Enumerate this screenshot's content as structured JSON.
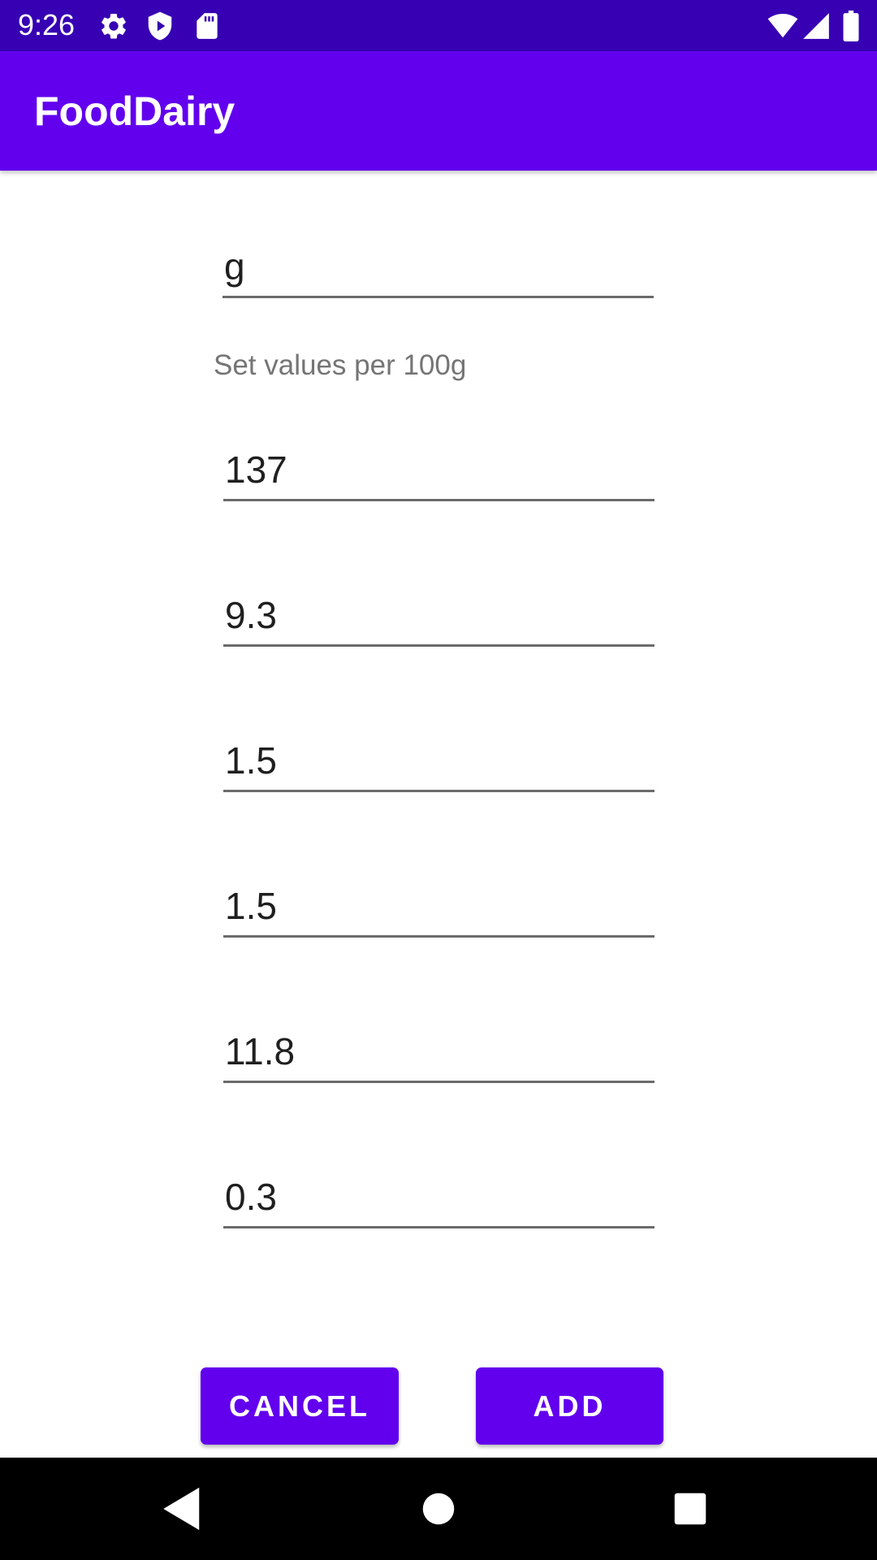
{
  "status_bar": {
    "time": "9:26",
    "icons": [
      "gear-icon",
      "shield-icon",
      "sd-card-icon",
      "wifi-icon",
      "signal-icon",
      "battery-icon"
    ]
  },
  "app_bar": {
    "title": "FoodDairy"
  },
  "form": {
    "unit_field": {
      "value": "g"
    },
    "hint": "Set values per 100g",
    "value_fields": [
      {
        "value": "137"
      },
      {
        "value": "9.3"
      },
      {
        "value": "1.5"
      },
      {
        "value": "1.5"
      },
      {
        "value": "11.8"
      },
      {
        "value": "0.3"
      }
    ]
  },
  "buttons": {
    "cancel_label": "CANCEL",
    "add_label": "ADD"
  },
  "nav_bar": {
    "icons": [
      "back-icon",
      "home-icon",
      "recents-icon"
    ]
  },
  "colors": {
    "status_bar": "#3700b3",
    "primary": "#6200ee",
    "nav_bar": "#000000"
  }
}
